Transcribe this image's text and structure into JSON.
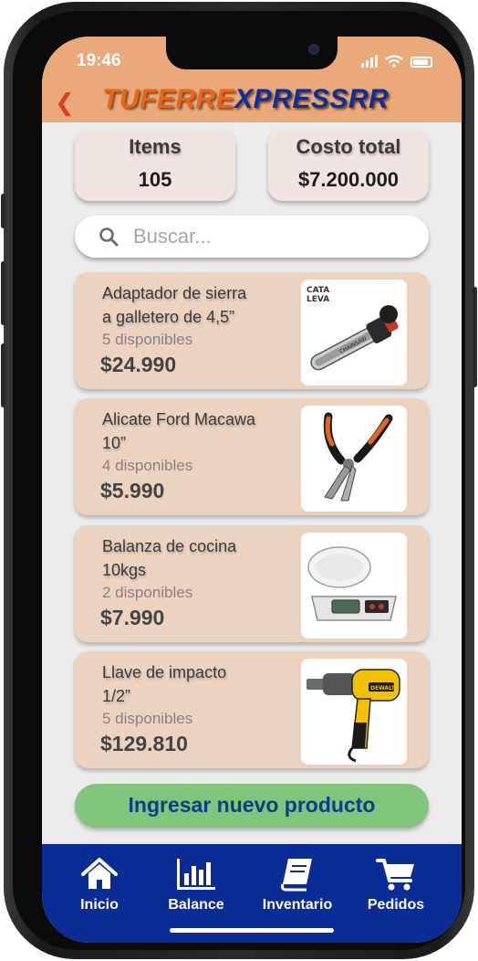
{
  "status_bar": {
    "time": "19:46"
  },
  "header": {
    "logo_part1": "TUFERRE",
    "logo_part2": "XPRESSRR",
    "brand_orange": "#e8661a",
    "brand_blue": "#0d2f9a",
    "header_color": "#e9a97a"
  },
  "summary": {
    "items_label": "Items",
    "items_value": "105",
    "cost_label": "Costo total",
    "cost_value": "$7.200.000"
  },
  "search": {
    "placeholder": "Buscar..."
  },
  "products": [
    {
      "name_line1": "Adaptador de sierra",
      "name_line2": "a galletero de 4,5”",
      "available": "5 disponibles",
      "price": "$24.990",
      "image_icon": "chainsaw-adapter-image",
      "brand_text": "CATA LEVA",
      "product_text": "CHAINSAW"
    },
    {
      "name_line1": "Alicate Ford Macawa",
      "name_line2": "10”",
      "available": "4 disponibles",
      "price": "$5.990",
      "image_icon": "pliers-image"
    },
    {
      "name_line1": "Balanza de cocina",
      "name_line2": "10kgs",
      "available": "2 disponibles",
      "price": "$7.990",
      "image_icon": "kitchen-scale-image"
    },
    {
      "name_line1": "Llave de impacto",
      "name_line2": "1/2”",
      "available": "5 disponibles",
      "price": "$129.810",
      "image_icon": "impact-wrench-image",
      "brand_text": "DEWALT"
    }
  ],
  "cta": {
    "label": "Ingresar nuevo producto",
    "color": "#81c47c"
  },
  "tabbar": {
    "color": "#0a2c95",
    "tabs": [
      {
        "label": "Inicio",
        "icon": "home-icon"
      },
      {
        "label": "Balance",
        "icon": "bar-chart-icon"
      },
      {
        "label": "Inventario",
        "icon": "book-icon"
      },
      {
        "label": "Pedidos",
        "icon": "cart-icon"
      }
    ]
  }
}
